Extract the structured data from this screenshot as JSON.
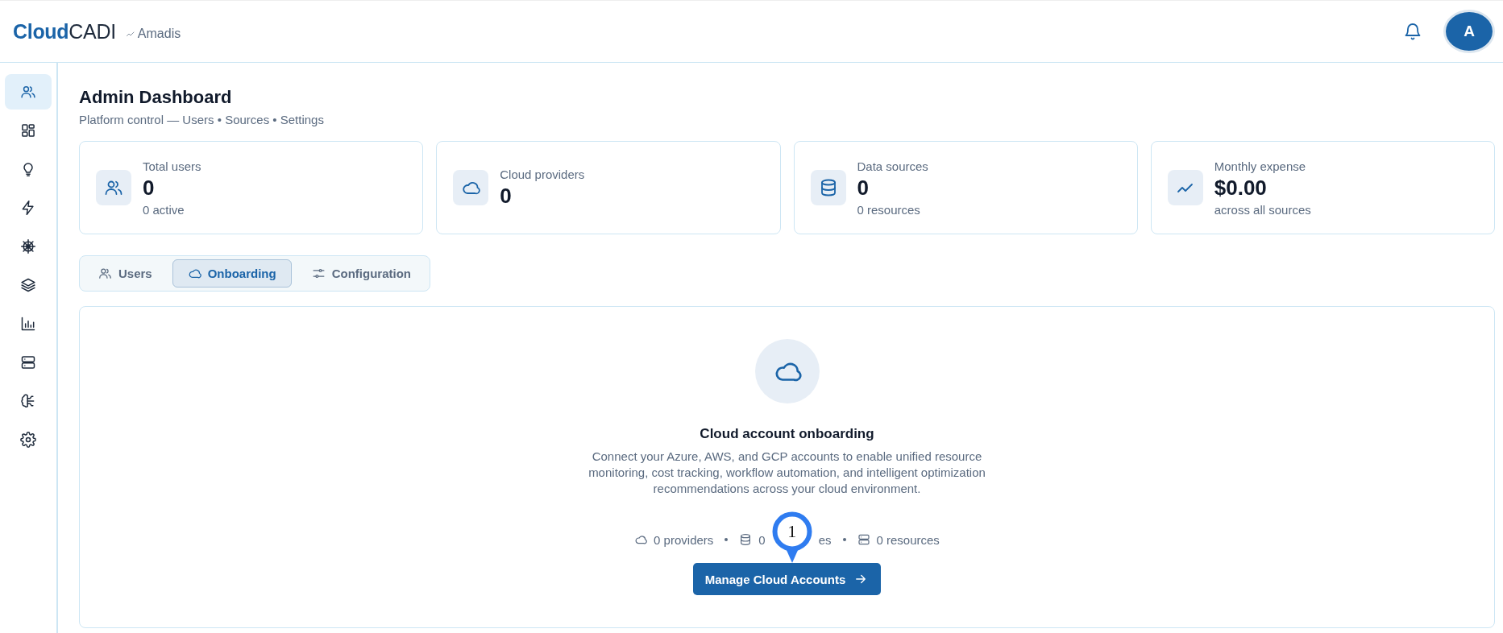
{
  "header": {
    "logo_bold": "Cloud",
    "logo_light": "CADI",
    "tenant": "Amadis",
    "avatar": "A"
  },
  "sidebar": {
    "items": [
      {
        "kind": "users",
        "selected": true
      },
      {
        "kind": "grid",
        "selected": false
      },
      {
        "kind": "bulb",
        "selected": false
      },
      {
        "kind": "bolt",
        "selected": false
      },
      {
        "kind": "helm",
        "selected": false
      },
      {
        "kind": "layers",
        "selected": false
      },
      {
        "kind": "chart",
        "selected": false
      },
      {
        "kind": "server",
        "selected": false
      },
      {
        "kind": "brain",
        "selected": false
      },
      {
        "kind": "settings",
        "selected": false
      }
    ]
  },
  "page": {
    "title": "Admin Dashboard",
    "subtitle": "Platform control — Users • Sources • Settings"
  },
  "stats": [
    {
      "kind": "users",
      "label": "Total users",
      "value": "0",
      "note": "0 active"
    },
    {
      "kind": "cloud",
      "label": "Cloud providers",
      "value": "0"
    },
    {
      "kind": "database",
      "label": "Data sources",
      "value": "0",
      "note": "0 resources"
    },
    {
      "kind": "trend",
      "label": "Monthly expense",
      "value": "$0.00",
      "note": "across all sources"
    }
  ],
  "tabs": [
    {
      "kind": "users",
      "label": "Users",
      "selected": false
    },
    {
      "kind": "cloud",
      "label": "Onboarding",
      "selected": true
    },
    {
      "kind": "sliders",
      "label": "Configuration",
      "selected": false
    }
  ],
  "onboarding": {
    "title": "Cloud account onboarding",
    "description": "Connect your Azure, AWS, and GCP accounts to enable unified resource monitoring, cost tracking, workflow automation, and intelligent optimization recommendations across your cloud environment.",
    "counts": [
      {
        "kind": "cloud",
        "text": "0 providers"
      },
      {
        "kind": "database",
        "text": "0",
        "text_after_marker": "es"
      },
      {
        "kind": "server",
        "text": "0 resources"
      }
    ],
    "button": "Manage Cloud Accounts",
    "marker": "1"
  }
}
